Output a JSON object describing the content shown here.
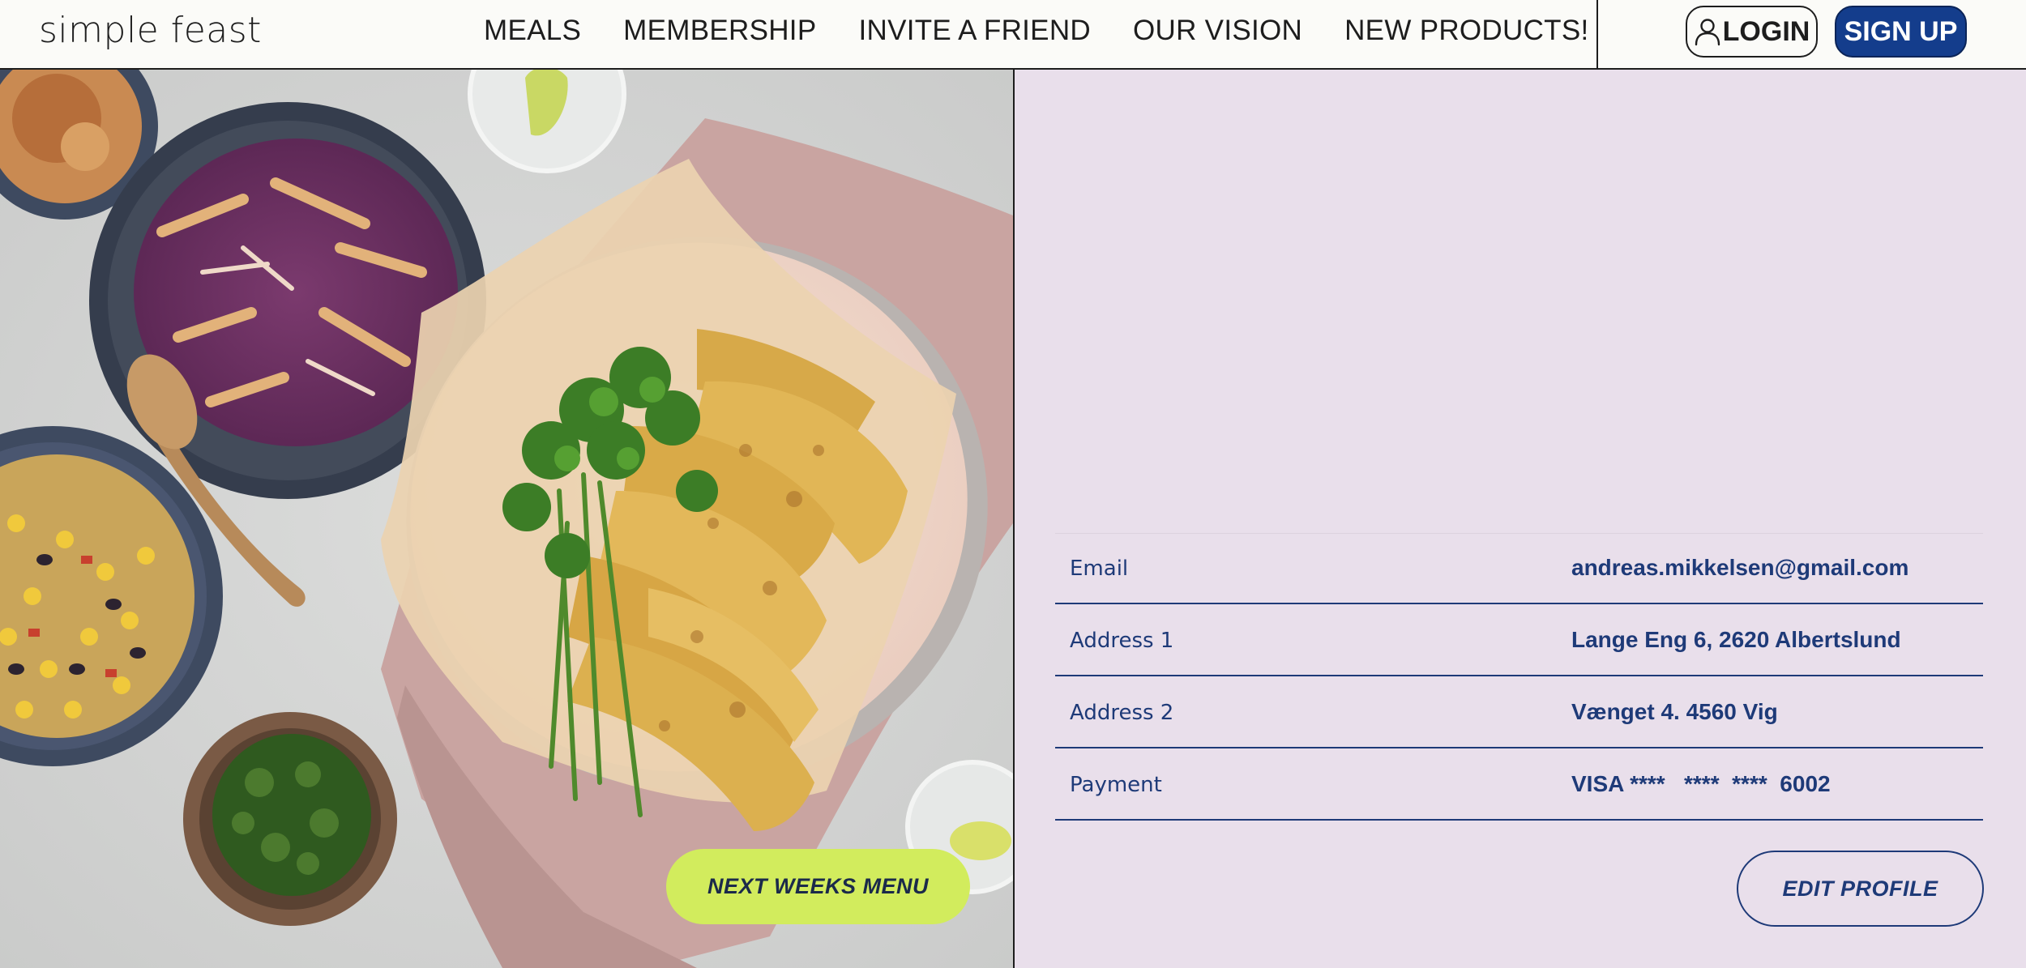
{
  "brand": {
    "logo": "simple feast"
  },
  "nav": {
    "items": [
      {
        "label": "MEALS"
      },
      {
        "label": "MEMBERSHIP"
      },
      {
        "label": "INVITE A FRIEND"
      },
      {
        "label": "OUR VISION"
      },
      {
        "label": "NEW PRODUCTS!"
      }
    ]
  },
  "auth": {
    "login_label": "LOGIN",
    "login_icon": "user-icon",
    "signup_label": "SIGN UP"
  },
  "hero": {
    "image": "food-photo",
    "cta_label": "NEXT WEEKS MENU"
  },
  "profile": {
    "rows": [
      {
        "label": "Email",
        "value": "andreas.mikkelsen@gmail.com"
      },
      {
        "label": "Address 1",
        "value": "Lange Eng 6, 2620 Albertslund"
      },
      {
        "label": "Address 2",
        "value": "Vænget 4. 4560 Vig"
      },
      {
        "label": "Payment",
        "value": "VISA ****   ****  ****  6002"
      }
    ],
    "edit_label": "EDIT PROFILE"
  },
  "colors": {
    "brand_blue": "#143d8c",
    "text_blue": "#1e3a78",
    "panel_bg": "#e9dfeb",
    "accent_lime": "#d2ec5d",
    "header_bg": "#fbfbf8"
  }
}
